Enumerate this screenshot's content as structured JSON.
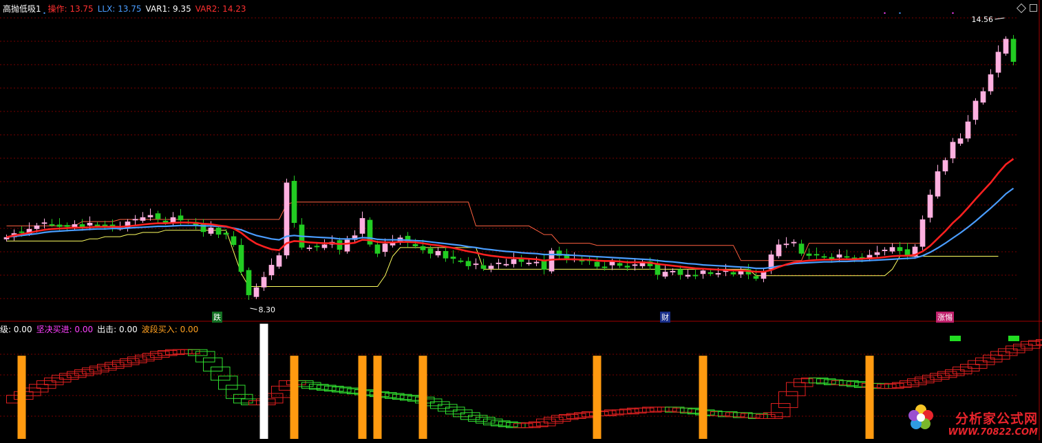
{
  "header_main": {
    "name": "高抛低吸1",
    "items": [
      {
        "label": "操作: 13.75",
        "color": "#ff3030"
      },
      {
        "label": "LLX: 13.75",
        "color": "#4a9dff"
      },
      {
        "label": "VAR1: 9.35",
        "color": "#ffffff"
      },
      {
        "label": "VAR2: 14.23",
        "color": "#ff3030"
      }
    ]
  },
  "header_sub": {
    "items": [
      {
        "label": "级: 0.00",
        "color": "#ffffff"
      },
      {
        "label": "坚决买进: 0.00",
        "color": "#ff40ff"
      },
      {
        "label": "出击: 0.00",
        "color": "#ffffff"
      },
      {
        "label": "波段买入: 0.00",
        "color": "#ffa020"
      }
    ]
  },
  "annotations": {
    "high_label": "14.56",
    "low_label": "8.30",
    "tag_die": "跌",
    "tag_cai": "财",
    "tag_zhangting": "涨惕"
  },
  "watermark": {
    "line1": "分析家公式网",
    "line2": "WWW.70822.COM"
  },
  "colors": {
    "up": "#ffb0e0",
    "down": "#22cc22",
    "ma_red": "#ff2020",
    "ma_blue": "#4a9dff",
    "upper_band": "#ff6040",
    "lower_band": "#ffff60",
    "grid": "#7a0000",
    "osc_up": "#e02020",
    "osc_down": "#30e030",
    "bar_orange": "#ff9a10",
    "bar_white": "#ffffff"
  },
  "chart_data": {
    "type": "candlestick",
    "y_range": [
      8.1,
      14.9
    ],
    "candles_close": [
      9.74,
      9.83,
      9.86,
      9.93,
      10.01,
      10.08,
      10.03,
      9.98,
      9.98,
      10.04,
      9.97,
      10.07,
      10.03,
      9.99,
      9.98,
      9.95,
      10.1,
      10.16,
      10.2,
      10.25,
      10.16,
      10.07,
      10.2,
      10.13,
      10.09,
      10.0,
      9.86,
      9.96,
      9.8,
      9.8,
      9.56,
      8.94,
      8.4,
      8.58,
      8.82,
      9.1,
      9.32,
      11.0,
      10.07,
      9.5,
      9.5,
      9.53,
      9.57,
      9.63,
      9.45,
      9.68,
      9.78,
      10.18,
      9.57,
      9.36,
      9.59,
      9.64,
      9.73,
      9.62,
      9.53,
      9.44,
      9.36,
      9.42,
      9.25,
      9.24,
      9.19,
      9.07,
      9.13,
      9.01,
      9.08,
      9.15,
      9.12,
      9.23,
      9.17,
      9.15,
      9.17,
      8.99,
      9.43,
      9.31,
      9.25,
      9.24,
      9.18,
      9.21,
      9.06,
      9.05,
      9.18,
      9.08,
      9.04,
      9.11,
      9.18,
      9.07,
      8.87,
      8.94,
      8.96,
      8.87,
      8.87,
      8.85,
      8.97,
      8.89,
      8.91,
      8.97,
      8.88,
      8.96,
      8.88,
      8.78,
      8.96,
      9.34,
      9.57,
      9.59,
      9.63,
      9.36,
      9.31,
      9.34,
      9.28,
      9.23,
      9.34,
      9.27,
      9.24,
      9.27,
      9.33,
      9.39,
      9.45,
      9.51,
      9.42,
      9.33,
      9.52,
      10.15,
      10.72,
      11.26,
      11.52,
      11.94,
      12.02,
      12.41,
      12.89,
      13.11,
      13.5,
      14.02,
      14.32,
      13.79
    ],
    "ma_red_values": [
      9.74,
      9.78,
      9.81,
      9.84,
      9.88,
      9.91,
      9.93,
      9.94,
      9.95,
      9.96,
      9.96,
      9.97,
      9.98,
      9.98,
      9.98,
      9.98,
      9.99,
      10.01,
      10.03,
      10.05,
      10.06,
      10.06,
      10.07,
      10.08,
      10.08,
      10.07,
      10.05,
      10.04,
      10.01,
      9.99,
      9.94,
      9.84,
      9.7,
      9.59,
      9.52,
      9.46,
      9.44,
      9.6,
      9.65,
      9.64,
      9.62,
      9.61,
      9.6,
      9.6,
      9.58,
      9.59,
      9.61,
      9.68,
      9.67,
      9.63,
      9.62,
      9.62,
      9.63,
      9.63,
      9.62,
      9.6,
      9.57,
      9.55,
      9.52,
      9.49,
      9.45,
      9.41,
      9.38,
      9.34,
      9.31,
      9.29,
      9.27,
      9.26,
      9.25,
      9.24,
      9.23,
      9.2,
      9.22,
      9.23,
      9.23,
      9.23,
      9.22,
      9.22,
      9.2,
      9.19,
      9.19,
      9.18,
      9.16,
      9.16,
      9.16,
      9.15,
      9.12,
      9.1,
      9.08,
      9.06,
      9.04,
      9.02,
      9.01,
      9.0,
      8.99,
      8.98,
      8.97,
      8.97,
      8.96,
      8.94,
      8.94,
      8.98,
      9.05,
      9.11,
      9.16,
      9.18,
      9.2,
      9.21,
      9.22,
      9.22,
      9.23,
      9.23,
      9.23,
      9.24,
      9.25,
      9.26,
      9.28,
      9.3,
      9.31,
      9.31,
      9.33,
      9.41,
      9.54,
      9.71,
      9.88,
      10.07,
      10.23,
      10.42,
      10.62,
      10.81,
      11.0,
      11.22,
      11.42,
      11.55
    ],
    "ma_blue_values": [
      9.74,
      9.76,
      9.78,
      9.8,
      9.82,
      9.85,
      9.87,
      9.88,
      9.89,
      9.9,
      9.91,
      9.92,
      9.93,
      9.93,
      9.94,
      9.94,
      9.95,
      9.96,
      9.97,
      9.98,
      9.99,
      9.99,
      10.0,
      10.01,
      10.01,
      10.01,
      10.0,
      10.0,
      9.99,
      9.98,
      9.95,
      9.91,
      9.84,
      9.78,
      9.74,
      9.7,
      9.68,
      9.76,
      9.78,
      9.76,
      9.75,
      9.74,
      9.73,
      9.72,
      9.7,
      9.7,
      9.7,
      9.73,
      9.72,
      9.69,
      9.68,
      9.68,
      9.68,
      9.67,
      9.66,
      9.65,
      9.63,
      9.61,
      9.59,
      9.57,
      9.55,
      9.52,
      9.5,
      9.47,
      9.45,
      9.43,
      9.41,
      9.4,
      9.38,
      9.37,
      9.36,
      9.34,
      9.34,
      9.34,
      9.33,
      9.32,
      9.31,
      9.3,
      9.29,
      9.28,
      9.27,
      9.26,
      9.25,
      9.24,
      9.23,
      9.22,
      9.2,
      9.18,
      9.17,
      9.15,
      9.13,
      9.12,
      9.1,
      9.09,
      9.08,
      9.07,
      9.06,
      9.05,
      9.04,
      9.02,
      9.02,
      9.04,
      9.07,
      9.1,
      9.13,
      9.14,
      9.15,
      9.16,
      9.17,
      9.17,
      9.18,
      9.18,
      9.19,
      9.19,
      9.2,
      9.21,
      9.22,
      9.23,
      9.24,
      9.25,
      9.26,
      9.31,
      9.39,
      9.49,
      9.6,
      9.72,
      9.84,
      9.97,
      10.11,
      10.26,
      10.41,
      10.57,
      10.74,
      10.87
    ],
    "upper_band_values": [
      10.0,
      10.0,
      10.0,
      10.0,
      10.0,
      10.0,
      10.0,
      10.0,
      10.0,
      10.0,
      10.1,
      10.1,
      10.1,
      10.1,
      10.1,
      10.15,
      10.15,
      10.15,
      10.15,
      10.15,
      10.15,
      10.15,
      10.15,
      10.15,
      10.15,
      10.15,
      10.15,
      10.15,
      10.15,
      10.15,
      10.15,
      10.15,
      10.15,
      10.15,
      10.15,
      10.15,
      10.15,
      10.5,
      10.55,
      10.55,
      10.55,
      10.55,
      10.55,
      10.55,
      10.55,
      10.55,
      10.55,
      10.55,
      10.55,
      10.55,
      10.55,
      10.55,
      10.55,
      10.55,
      10.55,
      10.55,
      10.55,
      10.55,
      10.55,
      10.55,
      10.55,
      10.55,
      10.0,
      10.0,
      10.0,
      10.0,
      10.0,
      10.0,
      10.0,
      10.0,
      9.9,
      9.8,
      9.8,
      9.6,
      9.6,
      9.6,
      9.6,
      9.6,
      9.55,
      9.55,
      9.55,
      9.55,
      9.55,
      9.55,
      9.55,
      9.55,
      9.55,
      9.55,
      9.55,
      9.55,
      9.55,
      9.55,
      9.55,
      9.55,
      9.55,
      9.55,
      9.55,
      9.2,
      9.2,
      9.2,
      9.2,
      9.2,
      9.2,
      9.2,
      9.2,
      9.2,
      9.6,
      9.6,
      9.6,
      9.6,
      9.6,
      9.6,
      9.6,
      9.6,
      9.6,
      9.6,
      9.6,
      9.6,
      9.6,
      9.6,
      9.6,
      9.6,
      null,
      null,
      null,
      null,
      null,
      null,
      null,
      null,
      null,
      null,
      null,
      null
    ],
    "lower_band_values": [
      9.65,
      9.65,
      9.65,
      9.65,
      9.65,
      9.65,
      9.65,
      9.65,
      9.65,
      9.65,
      9.65,
      9.7,
      9.7,
      9.75,
      9.75,
      9.75,
      9.8,
      9.8,
      9.85,
      9.85,
      9.85,
      9.9,
      9.9,
      9.9,
      9.9,
      9.9,
      9.9,
      9.9,
      9.9,
      9.9,
      9.4,
      8.9,
      8.6,
      8.6,
      8.6,
      8.6,
      8.6,
      8.6,
      8.6,
      8.6,
      8.6,
      8.6,
      8.6,
      8.6,
      8.6,
      8.6,
      8.6,
      8.6,
      8.6,
      8.6,
      8.85,
      9.3,
      9.5,
      9.5,
      9.5,
      9.5,
      9.5,
      9.5,
      9.5,
      9.5,
      9.5,
      9.5,
      9.5,
      9.0,
      9.0,
      9.0,
      9.0,
      9.0,
      9.0,
      9.0,
      9.0,
      9.0,
      9.0,
      9.0,
      9.0,
      9.0,
      9.0,
      9.0,
      9.0,
      9.0,
      9.0,
      9.0,
      9.0,
      9.0,
      9.0,
      9.0,
      9.0,
      9.0,
      9.0,
      9.0,
      9.0,
      9.0,
      9.0,
      9.0,
      9.0,
      9.0,
      9.0,
      9.0,
      9.0,
      8.85,
      8.85,
      8.85,
      8.85,
      8.85,
      8.85,
      8.85,
      8.85,
      8.85,
      8.85,
      8.85,
      8.85,
      8.85,
      8.85,
      8.85,
      8.85,
      8.85,
      8.85,
      9.0,
      9.3,
      9.3,
      9.3,
      9.3,
      9.3,
      9.3,
      9.3,
      9.3,
      9.3,
      9.3,
      9.3,
      9.3,
      9.3,
      9.3
    ],
    "oscillator_values": [
      40,
      44,
      48,
      52,
      56,
      60,
      63,
      66,
      68,
      70,
      72,
      74,
      76,
      78,
      80,
      82,
      84,
      86,
      88,
      90,
      92,
      93,
      94,
      94,
      94,
      92,
      85,
      75,
      65,
      55,
      45,
      40,
      38,
      38,
      40,
      46,
      54,
      60,
      60,
      58,
      56,
      55,
      54,
      53,
      52,
      51,
      50,
      49,
      48,
      47,
      46,
      45,
      44,
      43,
      42,
      40,
      37,
      34,
      31,
      28,
      25,
      22,
      20,
      18,
      16,
      15,
      14,
      13,
      13,
      14,
      15,
      18,
      20,
      22,
      23,
      24,
      25,
      26,
      26,
      27,
      28,
      28,
      29,
      30,
      30,
      31,
      31,
      31,
      30,
      30,
      29,
      28,
      27,
      26,
      26,
      25,
      25,
      24,
      24,
      23,
      23,
      25,
      35,
      48,
      58,
      62,
      63,
      62,
      61,
      60,
      60,
      59,
      58,
      57,
      57,
      56,
      56,
      57,
      58,
      60,
      62,
      64,
      66,
      68,
      70,
      72,
      75,
      78,
      82,
      85,
      88,
      92,
      95,
      98,
      100,
      103,
      104,
      105
    ],
    "signal_bars": [
      {
        "index": 2,
        "color": "orange",
        "height": 0.65
      },
      {
        "index": 34,
        "color": "white",
        "height": 0.9
      },
      {
        "index": 38,
        "color": "orange",
        "height": 0.65
      },
      {
        "index": 47,
        "color": "orange",
        "height": 0.65
      },
      {
        "index": 49,
        "color": "orange",
        "height": 0.65
      },
      {
        "index": 55,
        "color": "orange",
        "height": 0.65
      },
      {
        "index": 78,
        "color": "orange",
        "height": 0.65
      },
      {
        "index": 92,
        "color": "orange",
        "height": 0.65
      },
      {
        "index": 114,
        "color": "orange",
        "height": 0.65
      }
    ],
    "legend": "top-left"
  }
}
